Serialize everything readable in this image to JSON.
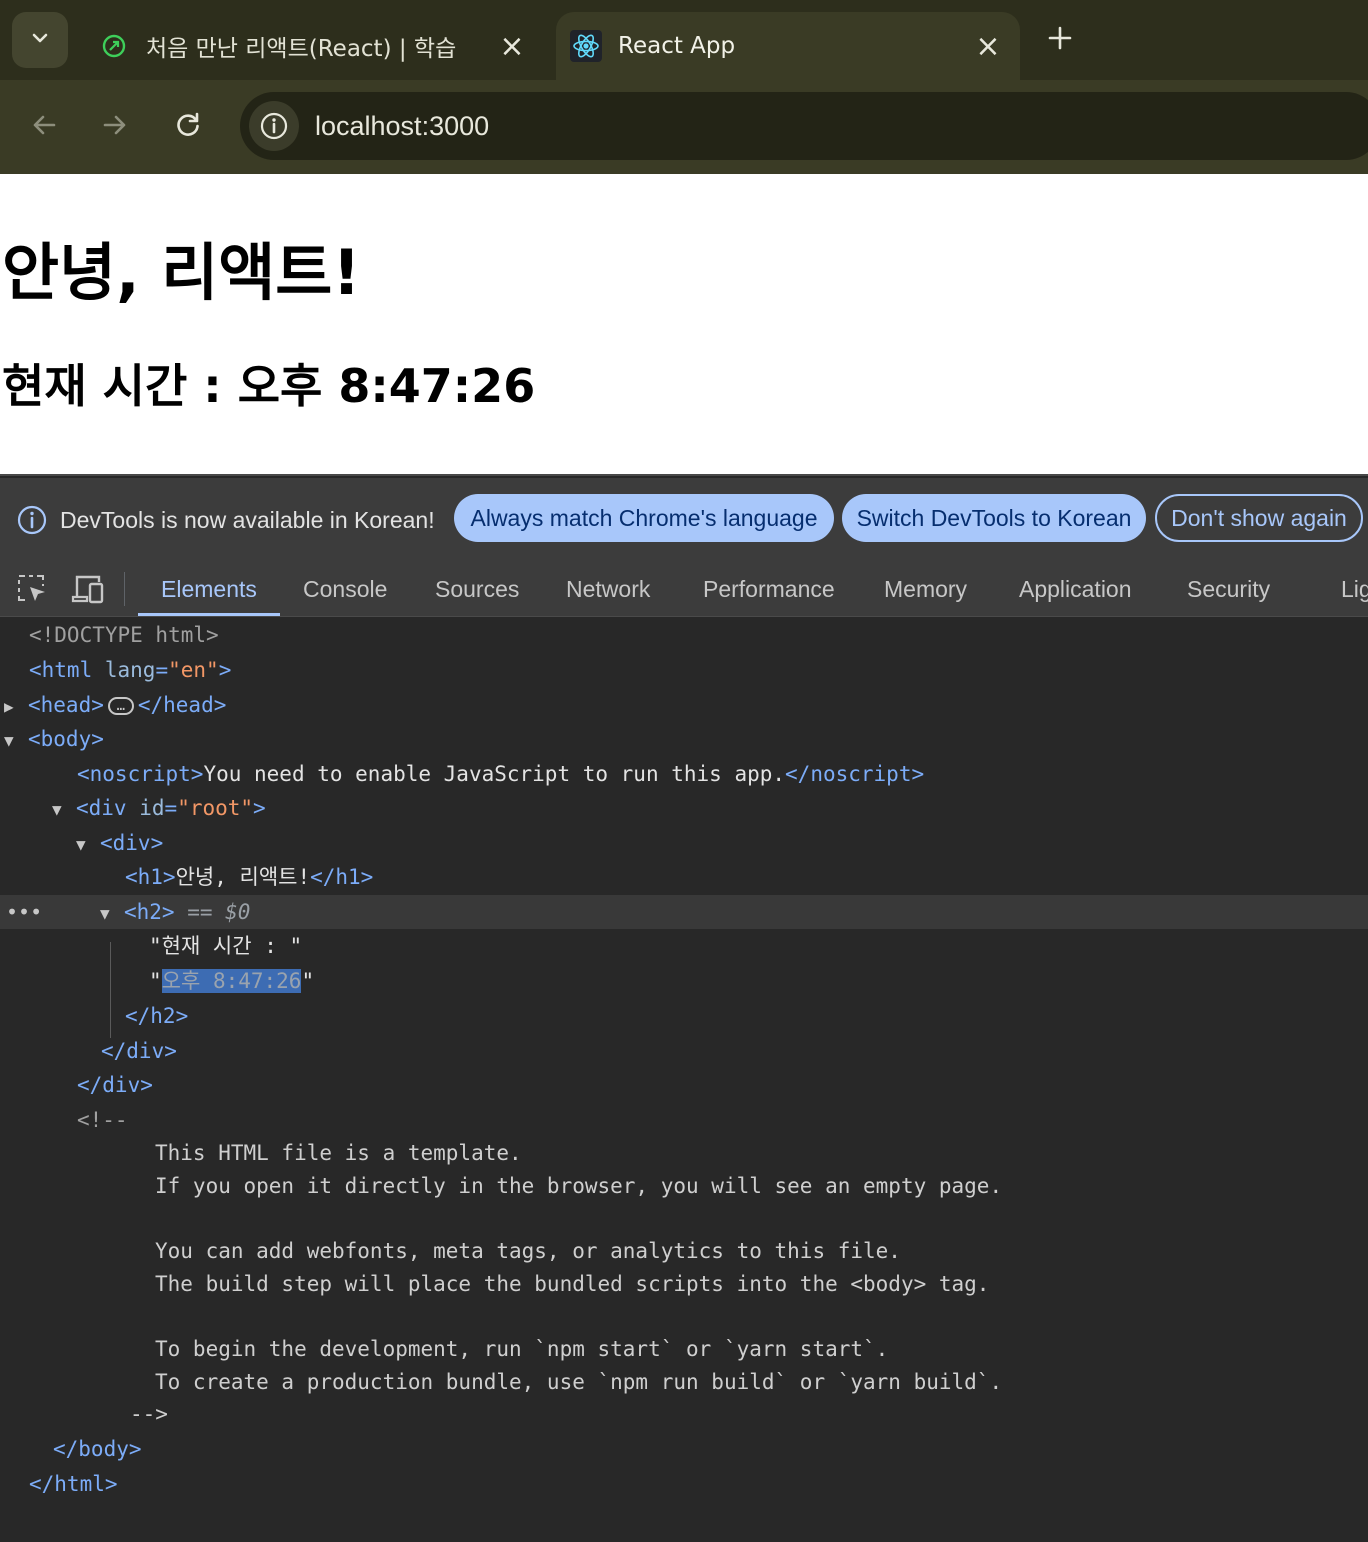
{
  "browser": {
    "tabs": [
      {
        "title": "처음 만난 리액트(React) | 학습",
        "active": false,
        "favicon": "leaf-icon"
      },
      {
        "title": "React App",
        "active": true,
        "favicon": "react-icon"
      }
    ],
    "url": "localhost:3000"
  },
  "page": {
    "h1": "안녕, 리액트!",
    "h2": "현재 시간 : 오후 8:47:26"
  },
  "devtools": {
    "infobar": {
      "message": "DevTools is now available in Korean!",
      "btn_match": "Always match Chrome's language",
      "btn_switch": "Switch DevTools to Korean",
      "btn_dismiss": "Don't show again"
    },
    "tabs": [
      "Elements",
      "Console",
      "Sources",
      "Network",
      "Performance",
      "Memory",
      "Application",
      "Security",
      "Lig"
    ],
    "active_tab": "Elements",
    "tree": {
      "doctype": "<!DOCTYPE html>",
      "html_open": "<html",
      "html_attr": "lang",
      "html_attr_val": "\"en\"",
      "head_open": "<head>",
      "head_ellipsis": "…",
      "head_close": "</head>",
      "body_open": "<body>",
      "noscript_open": "<noscript>",
      "noscript_text": "You need to enable JavaScript to run this app.",
      "noscript_close": "</noscript>",
      "div_root_open": "<div",
      "div_root_attr": "id",
      "div_root_attr_val": "\"root\"",
      "div_open": "<div>",
      "h1_open": "<h1>",
      "h1_text": "안녕, 리액트!",
      "h1_close": "</h1>",
      "h2_open": "<h2>",
      "h2_marker": "== $0",
      "h2_text1": "\"현재 시간 : \"",
      "h2_text2_quote_open": "\"",
      "h2_text2_value": "오후 8:47:26",
      "h2_text2_quote_close": "\"",
      "h2_close": "</h2>",
      "div_close": "</div>",
      "div_root_close": "</div>",
      "comment_open": "<!--",
      "comment_lines": [
        "This HTML file is a template.",
        "If you open it directly in the browser, you will see an empty page.",
        "",
        "You can add webfonts, meta tags, or analytics to this file.",
        "The build step will place the bundled scripts into the <body> tag.",
        "",
        "To begin the development, run `npm start` or `yarn start`.",
        "To create a production bundle, use `npm run build` or `yarn build`."
      ],
      "comment_close": "-->",
      "body_close": "</body>",
      "html_close": "</html>"
    }
  }
}
